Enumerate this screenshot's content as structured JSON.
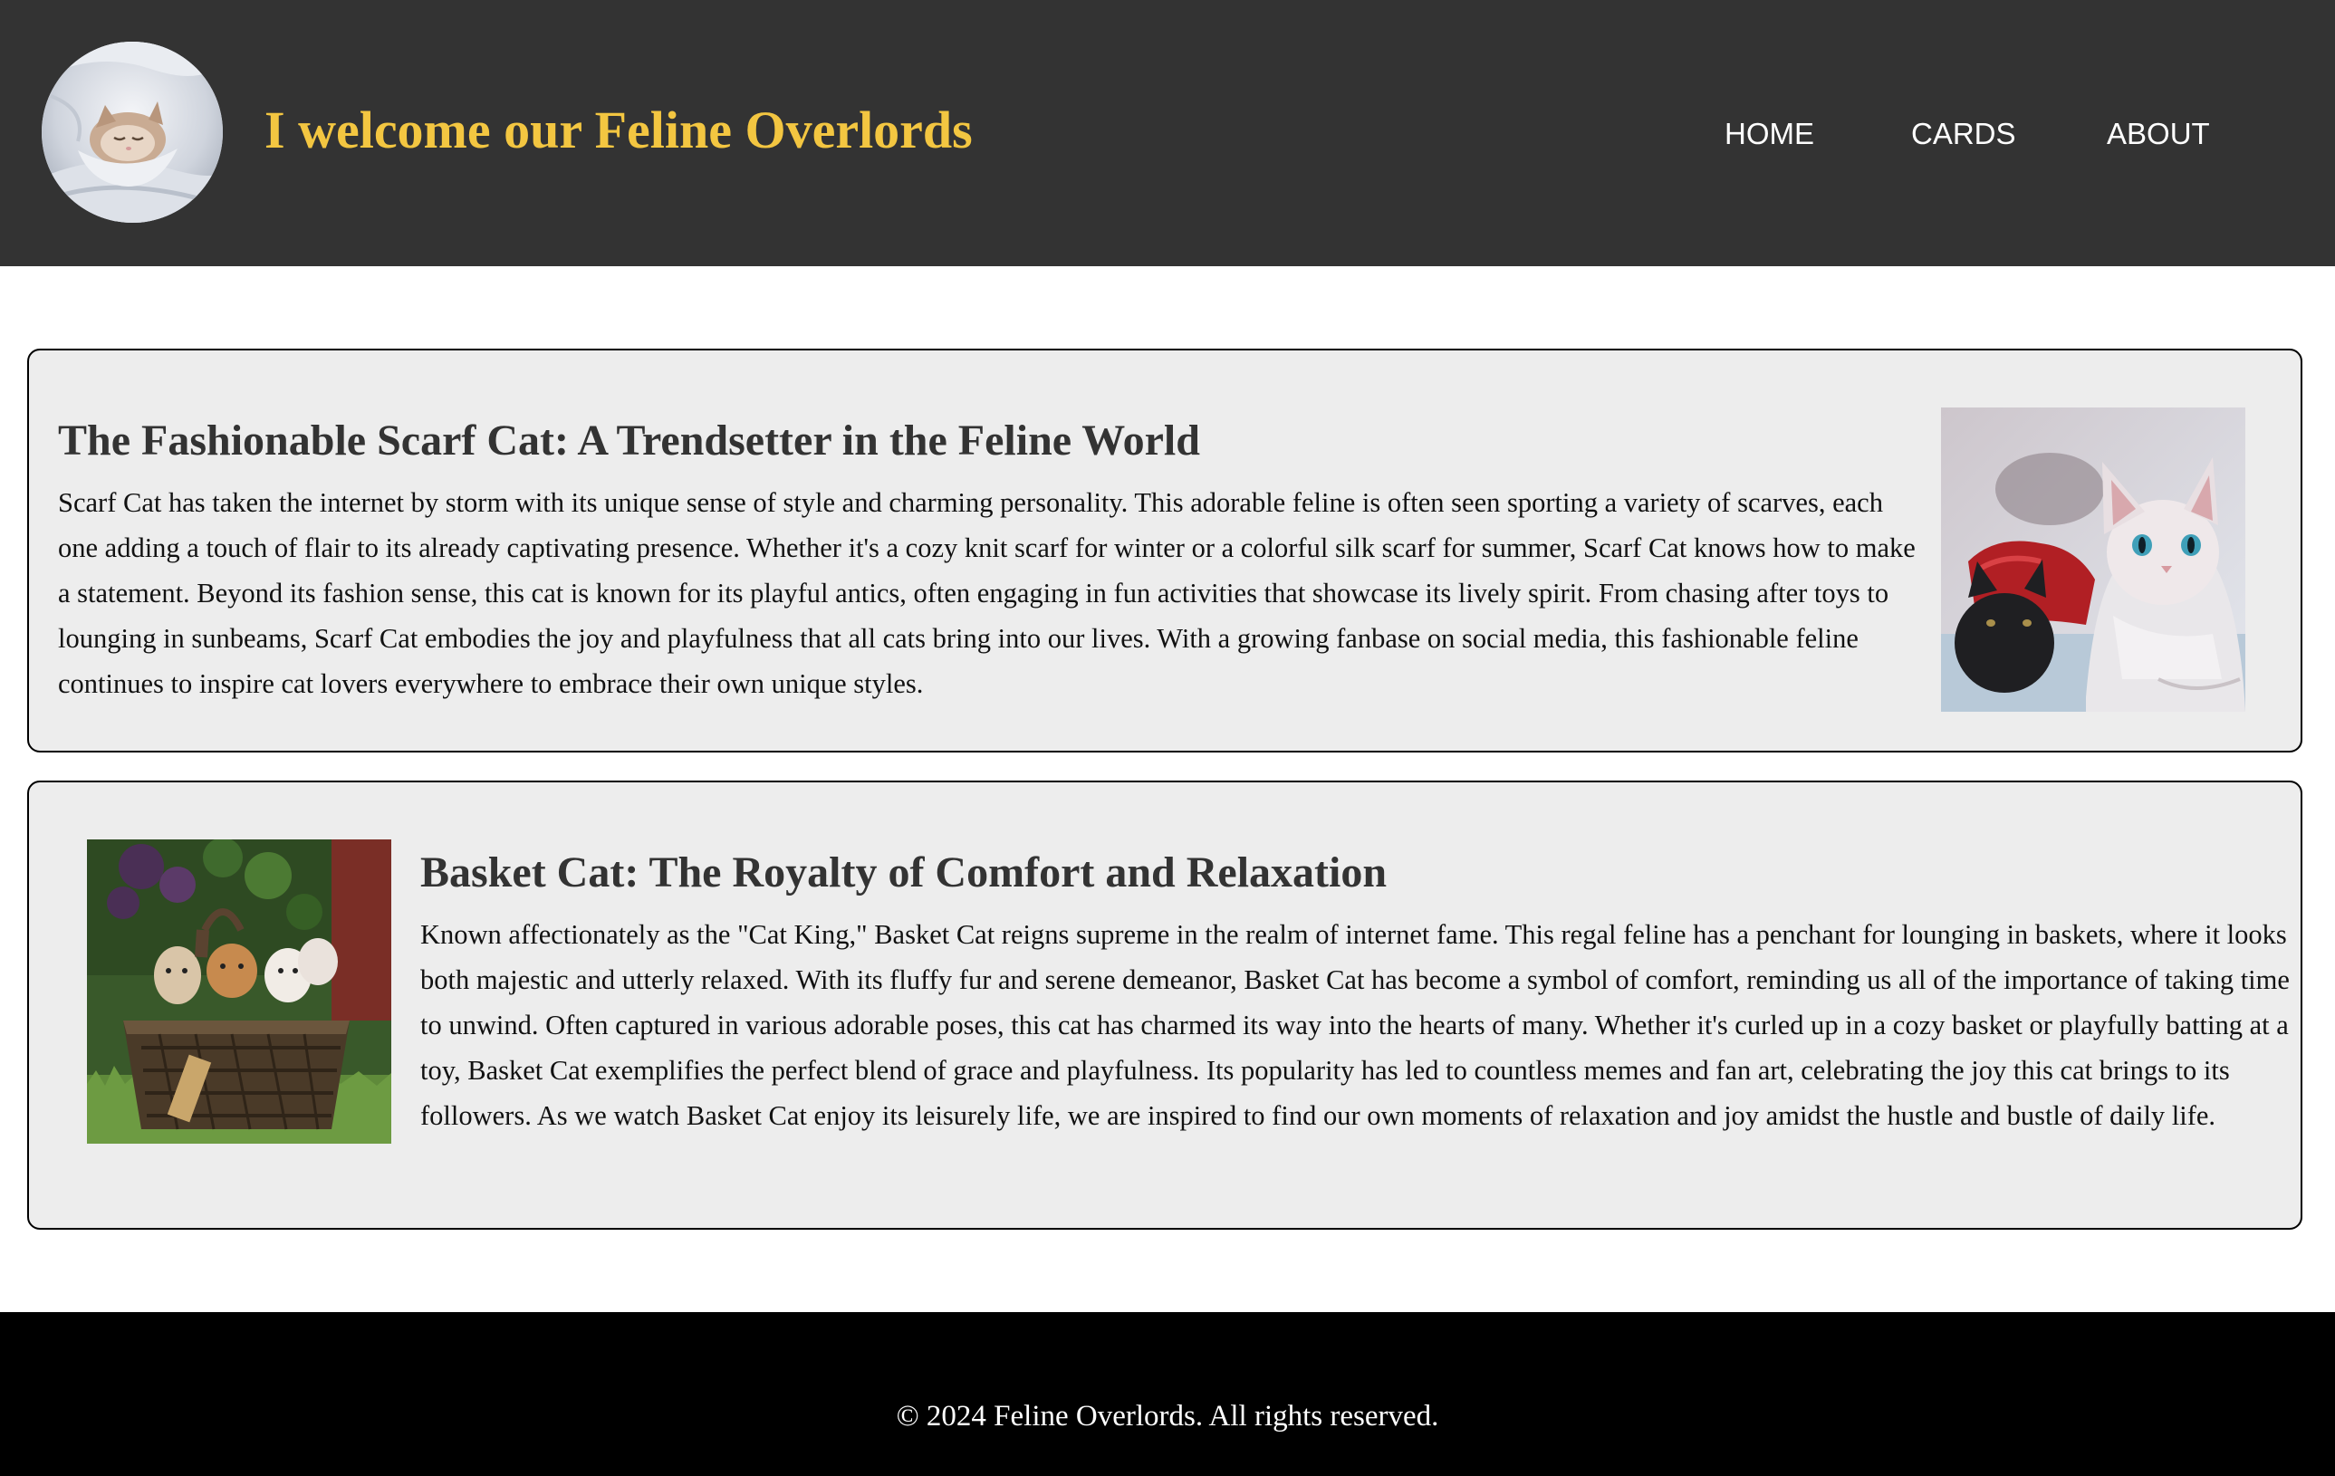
{
  "header": {
    "title": "I welcome our Feline Overlords",
    "logo_icon": "sleeping-kitten-blanket-photo",
    "nav": [
      {
        "label": "HOME"
      },
      {
        "label": "CARDS"
      },
      {
        "label": "ABOUT"
      }
    ]
  },
  "cards": [
    {
      "title": "The Fashionable Scarf Cat: A Trendsetter in the Feline World",
      "text": "Scarf Cat has taken the internet by storm with its unique sense of style and charming personality. This adorable feline is often seen sporting a variety of scarves, each one adding a touch of flair to its already captivating presence. Whether it's a cozy knit scarf for winter or a colorful silk scarf for summer, Scarf Cat knows how to make a statement. Beyond its fashion sense, this cat is known for its playful antics, often engaging in fun activities that showcase its lively spirit. From chasing after toys to lounging in sunbeams, Scarf Cat embodies the joy and playfulness that all cats bring into our lives. With a growing fanbase on social media, this fashionable feline continues to inspire cat lovers everywhere to embrace their own unique styles.",
      "image_icon": "kittens-red-scarf-photo"
    },
    {
      "title": "Basket Cat: The Royalty of Comfort and Relaxation",
      "text": "Known affectionately as the \"Cat King,\" Basket Cat reigns supreme in the realm of internet fame. This regal feline has a penchant for lounging in baskets, where it looks both majestic and utterly relaxed. With its fluffy fur and serene demeanor, Basket Cat has become a symbol of comfort, reminding us all of the importance of taking time to unwind. Often captured in various adorable poses, this cat has charmed its way into the hearts of many. Whether it's curled up in a cozy basket or playfully batting at a toy, Basket Cat exemplifies the perfect blend of grace and playfulness. Its popularity has led to countless memes and fan art, celebrating the joy this cat brings to its followers. As we watch Basket Cat enjoy its leisurely life, we are inspired to find our own moments of relaxation and joy amidst the hustle and bustle of daily life.",
      "image_icon": "kittens-in-basket-photo"
    }
  ],
  "footer": {
    "text": "© 2024 Feline Overlords. All rights reserved."
  },
  "colors": {
    "header_bg": "#333333",
    "title_accent": "#f3c641",
    "card_bg": "#ededed",
    "footer_bg": "#000000"
  }
}
